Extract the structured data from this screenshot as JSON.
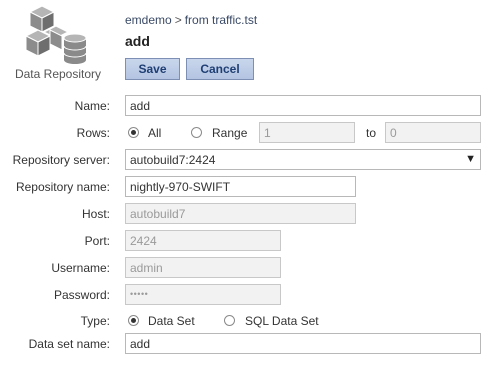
{
  "header": {
    "logo_label": "Data Repository",
    "breadcrumb": {
      "parent": "emdemo",
      "separator": ">",
      "current": "from traffic.tst"
    },
    "title": "add"
  },
  "actions": {
    "save_label": "Save",
    "cancel_label": "Cancel"
  },
  "form": {
    "name": {
      "label": "Name:",
      "value": "add"
    },
    "rows": {
      "label": "Rows:",
      "option_all": "All",
      "option_range": "Range",
      "selected": "All",
      "range_from": "1",
      "range_to_label": "to",
      "range_to": "0"
    },
    "repository_server": {
      "label": "Repository server:",
      "value": "autobuild7:2424"
    },
    "repository_name": {
      "label": "Repository name:",
      "value": "nightly-970-SWIFT"
    },
    "host": {
      "label": "Host:",
      "value": "autobuild7"
    },
    "port": {
      "label": "Port:",
      "value": "2424"
    },
    "username": {
      "label": "Username:",
      "value": "admin"
    },
    "password": {
      "label": "Password:",
      "value": "•••••"
    },
    "type": {
      "label": "Type:",
      "option_data_set": "Data Set",
      "option_sql": "SQL Data Set",
      "selected": "Data Set"
    },
    "data_set_name": {
      "label": "Data set name:",
      "value": "add"
    }
  },
  "colors": {
    "button_text": "#1f3f74",
    "button_bg": "#c1cfe8",
    "breadcrumb": "#3a4a66"
  }
}
